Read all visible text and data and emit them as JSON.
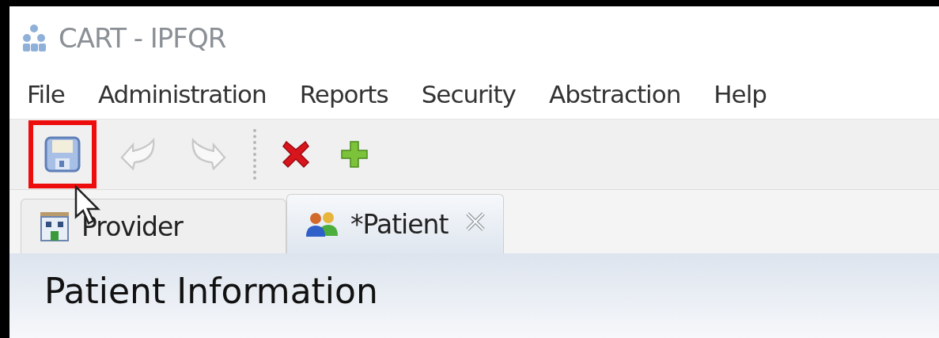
{
  "window": {
    "title": "CART - IPFQR"
  },
  "menu": [
    "File",
    "Administration",
    "Reports",
    "Security",
    "Abstraction",
    "Help"
  ],
  "toolbar": [
    {
      "kind": "save",
      "disabled": false,
      "highlighted": true
    },
    {
      "kind": "undo",
      "disabled": true,
      "highlighted": false
    },
    {
      "kind": "redo",
      "disabled": true,
      "highlighted": false
    },
    {
      "kind": "separator"
    },
    {
      "kind": "delete",
      "disabled": false,
      "highlighted": false
    },
    {
      "kind": "add",
      "disabled": false,
      "highlighted": false
    }
  ],
  "tabs": [
    {
      "label": "Provider",
      "selected": false,
      "closable": false
    },
    {
      "label": "*Patient",
      "selected": true,
      "closable": true
    }
  ],
  "content": {
    "heading": "Patient Information"
  }
}
